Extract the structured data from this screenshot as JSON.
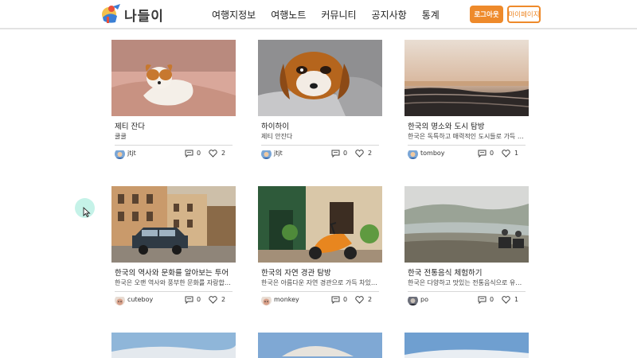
{
  "header": {
    "logo_text": "나들이",
    "nav": [
      "여행지정보",
      "여행노트",
      "커뮤니티",
      "공지사항",
      "통계"
    ],
    "logout_label": "로그아웃",
    "mypage_label": "마이페이지",
    "accent_color": "#ee8a2b"
  },
  "cards": [
    {
      "title": "제티 잔다",
      "desc": "쿨쿨",
      "author": "jtjt",
      "comments": "0",
      "likes": "2",
      "image": "dog-on-blanket"
    },
    {
      "title": "하이하이",
      "desc": "제티 안잔다",
      "author": "jtjt",
      "comments": "0",
      "likes": "2",
      "image": "dog-lying-down"
    },
    {
      "title": "한국의 명소와 도시 탐방",
      "desc": "한국은 독특하고 매력적인 도시들로 가득 차있...",
      "author": "tomboy",
      "comments": "0",
      "likes": "1",
      "image": "sunset-sea"
    },
    {
      "title": "한국의 역사와 문화를 알아보는 투어",
      "desc": "한국은 오랜 역사와 풍부한 문화를 자랑합니다...",
      "author": "cuteboy",
      "comments": "0",
      "likes": "2",
      "image": "old-town-street-with-car"
    },
    {
      "title": "한국의 자연 경관 탐방",
      "desc": "한국은 아름다운 자연 경관으로 가득 차있습니...",
      "author": "monkey",
      "comments": "0",
      "likes": "2",
      "image": "orange-scooter-cafe"
    },
    {
      "title": "한국 전통음식 체험하기",
      "desc": "한국은 다양하고 맛있는 전통음식으로 유명합...",
      "author": "po",
      "comments": "0",
      "likes": "1",
      "image": "misty-lakeside-chairs"
    }
  ]
}
